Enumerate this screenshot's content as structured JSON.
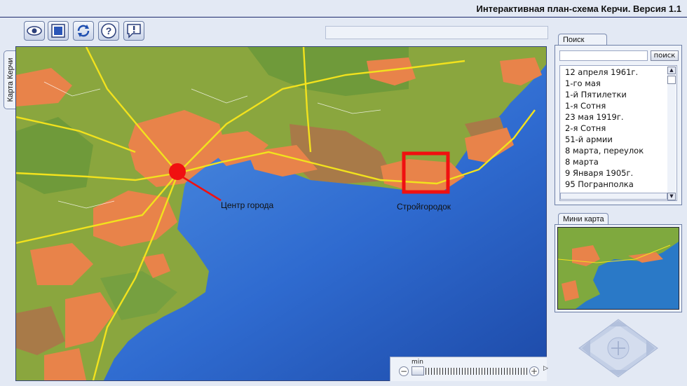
{
  "window": {
    "title": "Интерактивная план-схема Керчи. Версия 1.1"
  },
  "toolbar": {
    "buttons": [
      {
        "name": "view-button",
        "icon": "eye-icon"
      },
      {
        "name": "map-view-button",
        "icon": "map-tile-icon"
      },
      {
        "name": "refresh-button",
        "icon": "refresh-icon"
      },
      {
        "name": "help-button",
        "icon": "help-icon"
      },
      {
        "name": "info-button",
        "icon": "info-icon"
      }
    ],
    "status_text": ""
  },
  "side_tab": {
    "label": "Карта Керчи"
  },
  "map": {
    "markers": [
      {
        "name": "city-center-marker",
        "label": "Центр города"
      },
      {
        "name": "stroygorodok-marker",
        "label": "Стройгородок"
      }
    ],
    "colors": {
      "sea": "#2e6fd0",
      "land": "#8aa63e",
      "urban": "#e8834a",
      "roads": "#f2e21d",
      "marker": "#f01010"
    }
  },
  "zoom": {
    "min_label": "min",
    "minus": "−",
    "plus": "+",
    "arrow": "▷",
    "level": 0.03
  },
  "search": {
    "tab_label": "Поиск",
    "input_value": "",
    "button_label": "поиск",
    "results": [
      "12 апреля 1961г.",
      "1-го мая",
      "1-й Пятилетки",
      "1-я Сотня",
      "23 мая 1919г.",
      "2-я Сотня",
      "51-й армии",
      "8 марта, переулок",
      "8 марта",
      "9 Января 1905г.",
      "95 Погранполка"
    ]
  },
  "minimap": {
    "tab_label": "Мини карта"
  }
}
